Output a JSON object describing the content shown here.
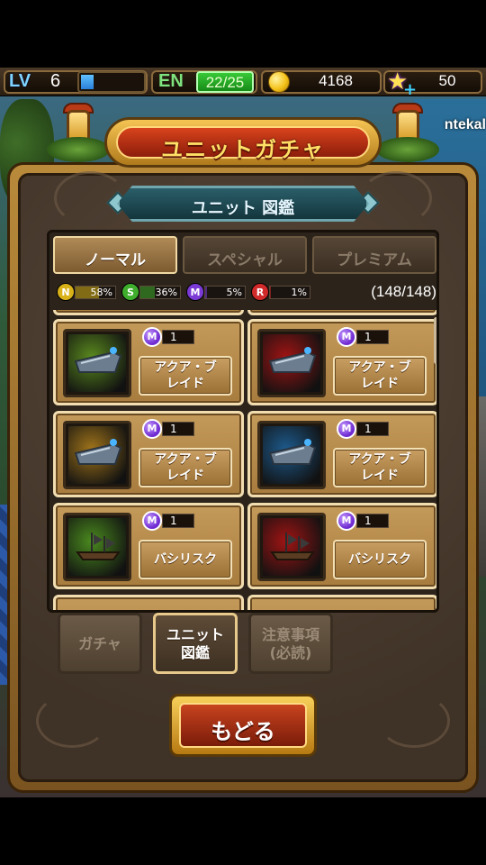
{
  "status": {
    "lv_label": "LV",
    "lv_value": "6",
    "lv_progress": 0.2,
    "en_label": "EN",
    "en_value": "22/25",
    "coins": "4168",
    "stars": "50"
  },
  "username_fragment": "ntekal",
  "title": "ユニットガチャ",
  "subtitle": "ユニット 図鑑",
  "tabs": [
    {
      "label": "ノーマル",
      "active": true
    },
    {
      "label": "スペシャル",
      "active": false
    },
    {
      "label": "プレミアム",
      "active": false
    }
  ],
  "rates": [
    {
      "badge": "N",
      "value": "58%",
      "color": "#d9b21a"
    },
    {
      "badge": "S",
      "value": "36%",
      "color": "#3fae2c"
    },
    {
      "badge": "M",
      "value": "5%",
      "color": "#7b3ad6"
    },
    {
      "badge": "R",
      "value": "1%",
      "color": "#d12a2a"
    }
  ],
  "count": "(148/148)",
  "cards": [
    {
      "rank": "M",
      "rank_value": "1",
      "name_line1": "アクア・ブ",
      "name_line2": "レイド",
      "bg": "#5a8a1e",
      "icon": "aqua-blade-icon"
    },
    {
      "rank": "M",
      "rank_value": "1",
      "name_line1": "アクア・ブ",
      "name_line2": "レイド",
      "bg": "#a01414",
      "icon": "aqua-blade-icon"
    },
    {
      "rank": "M",
      "rank_value": "1",
      "name_line1": "アクア・ブ",
      "name_line2": "レイド",
      "bg": "#a0741a",
      "icon": "aqua-blade-icon"
    },
    {
      "rank": "M",
      "rank_value": "1",
      "name_line1": "アクア・ブ",
      "name_line2": "レイド",
      "bg": "#1d5a8c",
      "icon": "aqua-blade-icon"
    },
    {
      "rank": "M",
      "rank_value": "1",
      "name_line1": "バシリスク",
      "name_line2": "",
      "bg": "#4a8a1e",
      "icon": "basilisk-ship-icon"
    },
    {
      "rank": "M",
      "rank_value": "1",
      "name_line1": "バシリスク",
      "name_line2": "",
      "bg": "#a01414",
      "icon": "basilisk-ship-icon"
    }
  ],
  "sub_tabs": [
    {
      "line1": "ガチャ",
      "line2": "",
      "active": false
    },
    {
      "line1": "ユニット",
      "line2": "図鑑",
      "active": true
    },
    {
      "line1": "注意事項",
      "line2": "(必読)",
      "active": false
    }
  ],
  "back_label": "もどる"
}
